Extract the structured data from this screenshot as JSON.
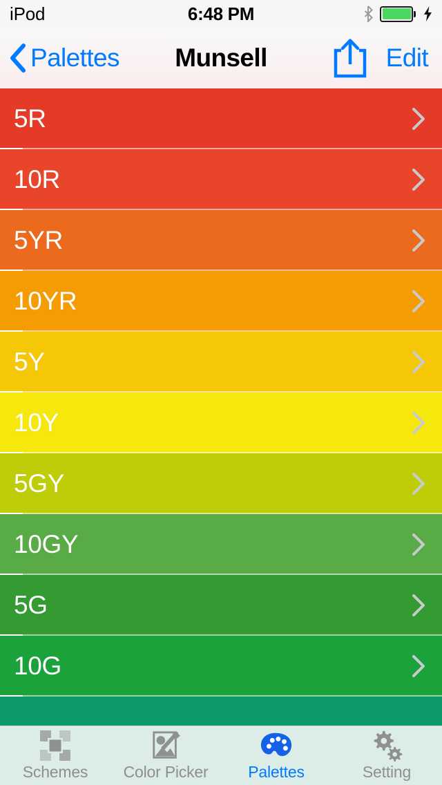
{
  "status_bar": {
    "carrier": "iPod",
    "time": "6:48 PM",
    "bluetooth_icon": "bluetooth-icon",
    "battery_icon": "battery-full-icon",
    "charging_icon": "charging-bolt-icon",
    "battery_level_percent": 100,
    "battery_color": "#4cd662"
  },
  "nav_bar": {
    "back_label": "Palettes",
    "back_icon": "chevron-left-icon",
    "title": "Munsell",
    "share_icon": "share-icon",
    "edit_label": "Edit",
    "tint_color": "#007aff"
  },
  "list": {
    "disclosure_icon": "chevron-right-icon",
    "rows": [
      {
        "label": "5R",
        "color": "#e63a28"
      },
      {
        "label": "10R",
        "color": "#e9452a"
      },
      {
        "label": "5YR",
        "color": "#ec6a1e"
      },
      {
        "label": "10YR",
        "color": "#f59c02"
      },
      {
        "label": "5Y",
        "color": "#f6c707"
      },
      {
        "label": "10Y",
        "color": "#f6e70c"
      },
      {
        "label": "5GY",
        "color": "#bfcc08"
      },
      {
        "label": "10GY",
        "color": "#58ab45"
      },
      {
        "label": "5G",
        "color": "#339b32"
      },
      {
        "label": "10G",
        "color": "#1ba23b"
      },
      {
        "label": "",
        "color": "#0f9a6e"
      }
    ]
  },
  "tab_bar": {
    "background": "#dcece6",
    "inactive_color": "#8e8e93",
    "active_color": "#007aff",
    "tabs": [
      {
        "label": "Schemes",
        "icon": "schemes-grid-icon",
        "active": false
      },
      {
        "label": "Color Picker",
        "icon": "eyedropper-photo-icon",
        "active": false
      },
      {
        "label": "Palettes",
        "icon": "palette-icon",
        "active": true
      },
      {
        "label": "Setting",
        "icon": "gears-icon",
        "active": false
      }
    ]
  }
}
